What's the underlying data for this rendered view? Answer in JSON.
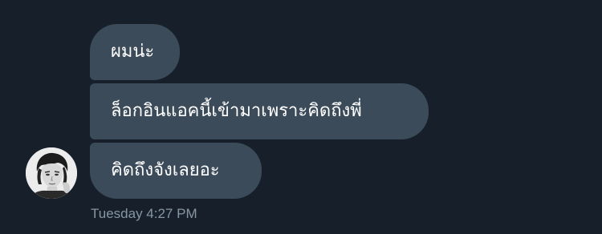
{
  "messages": [
    {
      "text": "ผมน่ะ"
    },
    {
      "text": "ล็อกอินแอคนี้เข้ามาเพราะคิดถึงพี่"
    },
    {
      "text": "คิดถึงจังเลยอะ"
    }
  ],
  "timestamp": "Tuesday 4:27 PM",
  "colors": {
    "background": "#17202a",
    "bubble": "#3c4b5a",
    "message_text": "#ffffff",
    "timestamp_text": "#8796a4"
  },
  "icons": {
    "avatar": "user-avatar-photo"
  }
}
